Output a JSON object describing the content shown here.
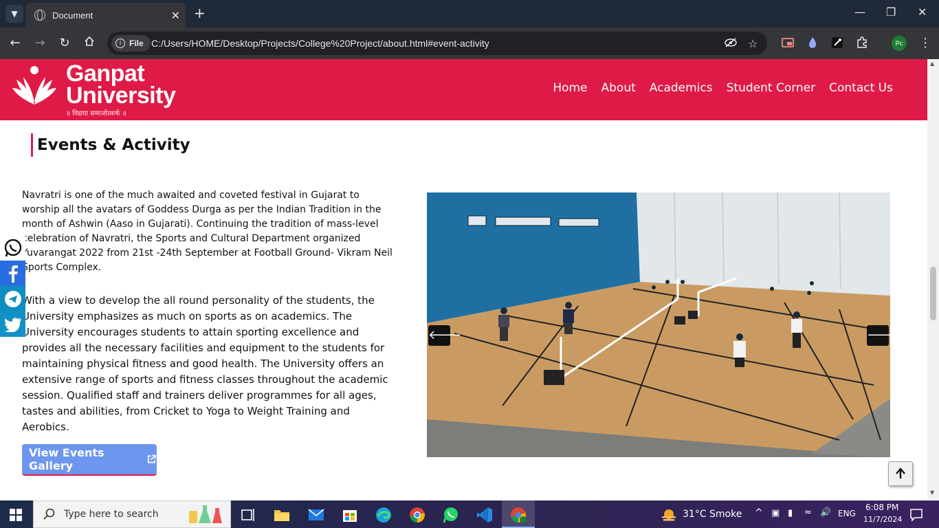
{
  "browser": {
    "tab_title": "Document",
    "file_label": "File",
    "url": "C:/Users/HOME/Desktop/Projects/College%20Project/about.html#event-activity",
    "profile_initials": "Pc"
  },
  "site": {
    "logo": {
      "line1": "Ganpat",
      "line2": "University",
      "tagline": "॥ विद्यया समाजोत्कर्षः ॥"
    },
    "nav": [
      "Home",
      "About",
      "Academics",
      "Student Corner",
      "Contact Us"
    ],
    "brand_color": "#e01a46"
  },
  "section": {
    "title": "Events & Activity",
    "paragraph1": "Navratri is one of the much awaited and coveted festival in Gujarat to worship all the avatars of Goddess Durga as per the Indian Tradition in the month of Ashwin (Aaso in Gujarati). Continuing the tradition of mass-level celebration of Navratri, the Sports and Cultural Department organized Yuvarangat 2022 from 21st -24th September at Football Ground- Vikram Neil Sports Complex.",
    "paragraph2": "With a view to develop the all round personality of the students, the University emphasizes as much on sports as on academics. The University encourages students to attain sporting excellence and provides all the necessary facilities and equipment to the students for maintaining physical fitness and good health. The University offers an extensive range of sports and fitness classes throughout the academic session. Qualified staff and trainers deliver programmes for all ages, tastes and abilities, from Cricket to Yoga to Weight Training and Aerobics.",
    "gallery_button": "View Events Gallery",
    "carousel_image": "indoor-badminton-court-photo"
  },
  "social_icons": [
    "whatsapp-icon",
    "facebook-icon",
    "telegram-icon",
    "twitter-icon"
  ],
  "taskbar": {
    "search_placeholder": "Type here to search",
    "weather_temp": "31°C",
    "weather_desc": "Smoke",
    "language": "ENG",
    "time": "6:08 PM",
    "date": "11/7/2024"
  }
}
